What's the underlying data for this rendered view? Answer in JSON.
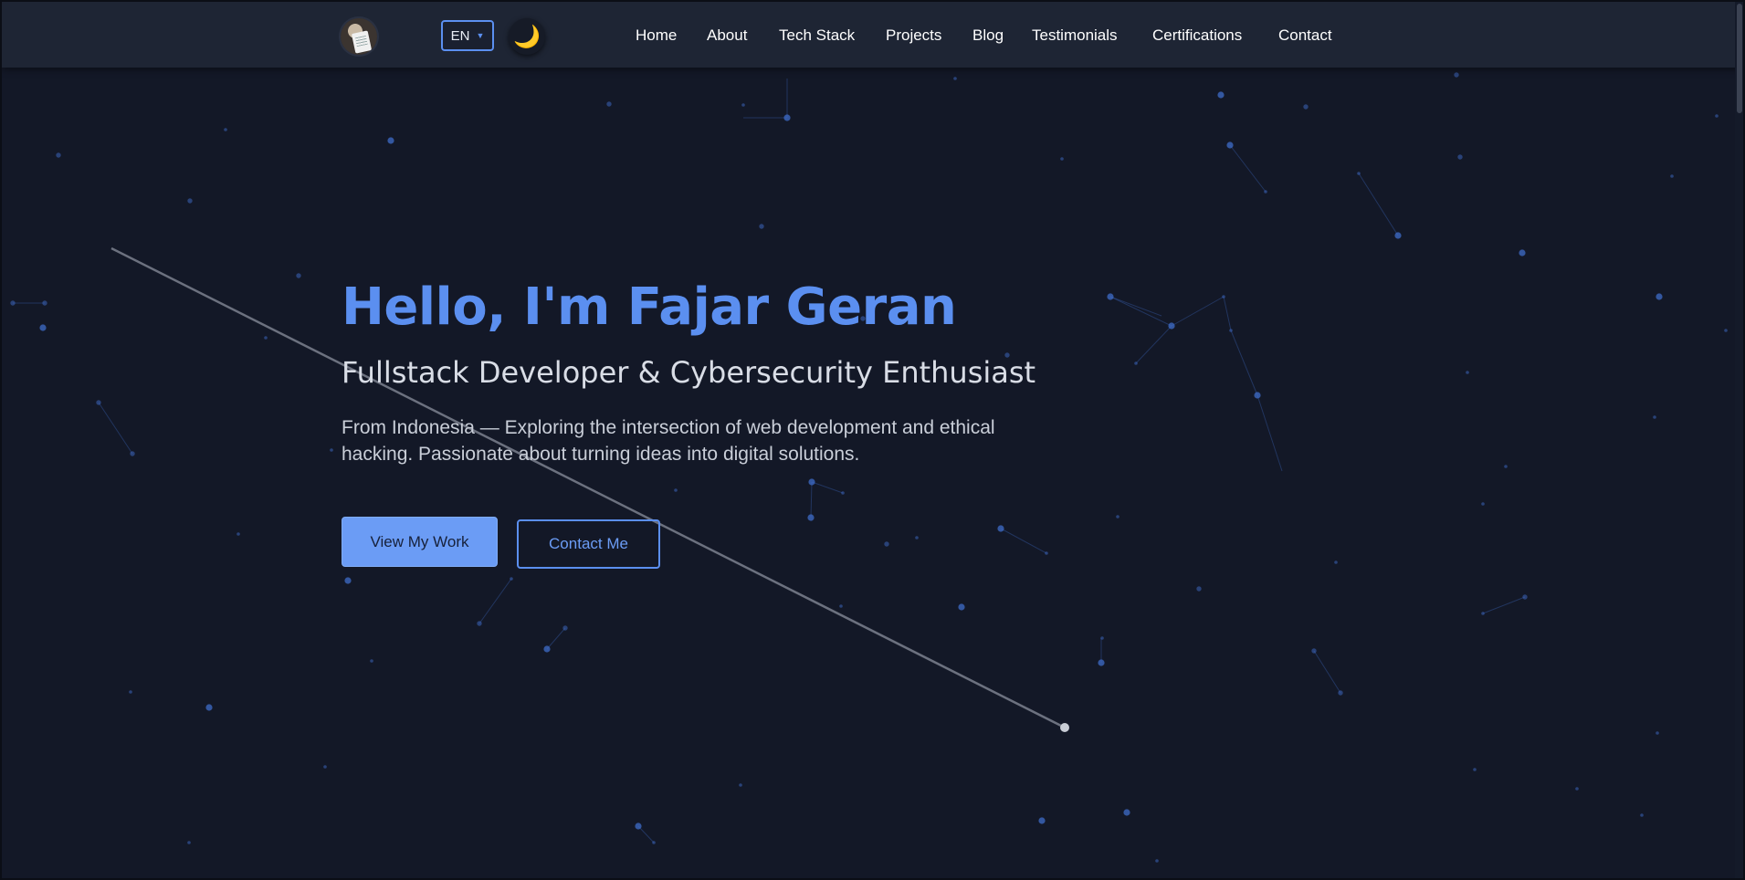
{
  "header": {
    "language": {
      "selected": "EN"
    },
    "theme_toggle_icon": "moon-icon",
    "nav": [
      {
        "label": "Home"
      },
      {
        "label": "About"
      },
      {
        "label": "Tech Stack"
      },
      {
        "label": "Projects"
      },
      {
        "label": "Blog"
      },
      {
        "label": "Testimonials"
      },
      {
        "label": "Certifications"
      },
      {
        "label": "Contact"
      }
    ]
  },
  "hero": {
    "title": "Hello, I'm Fajar Geran",
    "subtitle": "Fullstack Developer & Cybersecurity Enthusiast",
    "description": "From Indonesia — Exploring the intersection of web development and ethical hacking. Passionate about turning ideas into digital solutions.",
    "primary_button": "View My Work",
    "secondary_button": "Contact Me"
  },
  "colors": {
    "background": "#131827",
    "navbar": "#1e2534",
    "accent": "#5b8ff0",
    "star": "#3f6cc9"
  }
}
